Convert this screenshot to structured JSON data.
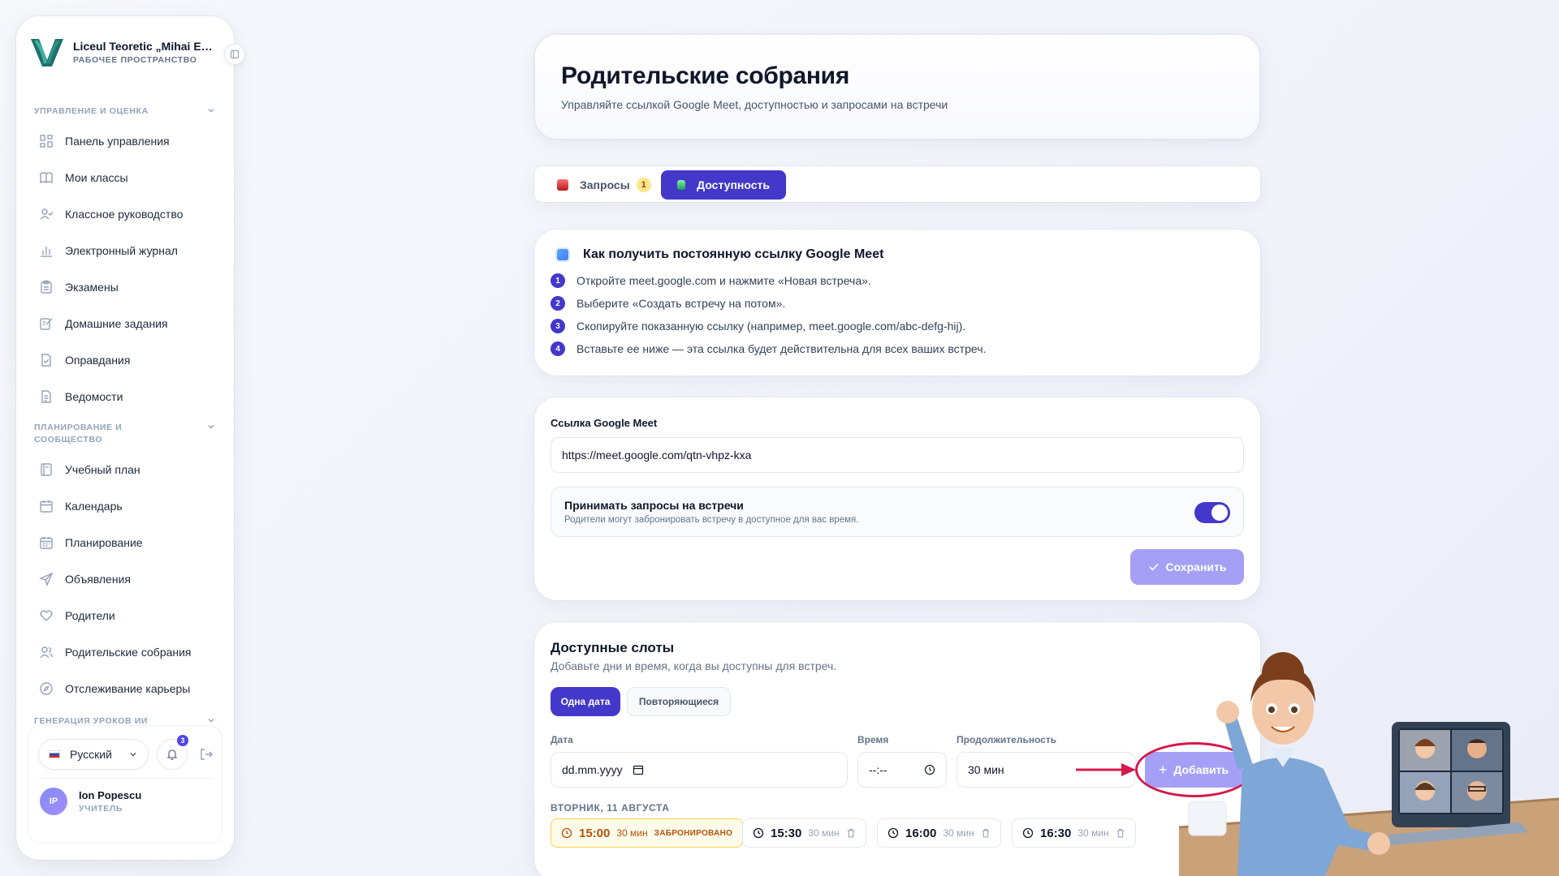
{
  "workspace": {
    "name": "Liceul Teoretic „Mihai Emi...",
    "subtitle": "РАБОЧЕЕ ПРОСТРАНСТВО"
  },
  "sidebar": {
    "sections": [
      {
        "title": "УПРАВЛЕНИЕ И ОЦЕНКА"
      },
      {
        "title": "ПЛАНИРОВАНИЕ И СООБЩЕСТВО"
      },
      {
        "title": "ГЕНЕРАЦИЯ УРОКОВ ИИ"
      }
    ],
    "items": [
      {
        "label": "Панель управления",
        "icon": "grid-icon"
      },
      {
        "label": "Мои классы",
        "icon": "book-open-icon"
      },
      {
        "label": "Классное руководство",
        "icon": "user-check-icon"
      },
      {
        "label": "Электронный журнал",
        "icon": "bar-chart-icon"
      },
      {
        "label": "Экзамены",
        "icon": "clipboard-icon"
      },
      {
        "label": "Домашние задания",
        "icon": "edit-note-icon"
      },
      {
        "label": "Оправдания",
        "icon": "file-check-icon"
      },
      {
        "label": "Ведомости",
        "icon": "file-text-icon"
      },
      {
        "label": "Учебный план",
        "icon": "notebook-icon"
      },
      {
        "label": "Календарь",
        "icon": "calendar-icon"
      },
      {
        "label": "Планирование",
        "icon": "calendar-grid-icon"
      },
      {
        "label": "Объявления",
        "icon": "send-icon"
      },
      {
        "label": "Родители",
        "icon": "heart-icon"
      },
      {
        "label": "Родительские собрания",
        "icon": "users-icon"
      },
      {
        "label": "Отслеживание карьеры",
        "icon": "compass-icon"
      }
    ],
    "footer": {
      "language": "Русский",
      "notifications_count": "3",
      "user_initials": "IP",
      "user_name": "Ion Popescu",
      "user_role": "УЧИТЕЛЬ"
    }
  },
  "page": {
    "title": "Родительские собрания",
    "subtitle": "Управляйте ссылкой Google Meet, доступностью и запросами на встречи"
  },
  "tabs": [
    {
      "label": "Запросы",
      "count": "1",
      "active": false
    },
    {
      "label": "Доступность",
      "active": true
    }
  ],
  "howto": {
    "title": "Как получить постоянную ссылку Google Meet",
    "steps": [
      {
        "n": "1",
        "text": "Откройте meet.google.com и нажмите «Новая встреча»."
      },
      {
        "n": "2",
        "text": "Выберите «Создать встречу на потом»."
      },
      {
        "n": "3",
        "text": "Скопируйте показанную ссылку (например, meet.google.com/abc-defg-hij)."
      },
      {
        "n": "4",
        "text": "Вставьте ее ниже — эта ссылка будет действительна для всех ваших встреч."
      }
    ]
  },
  "meet": {
    "label": "Ссылка Google Meet",
    "value": "https://meet.google.com/qtn-vhpz-kxa",
    "toggle_title": "Принимать запросы на встречи",
    "toggle_sub": "Родители могут забронировать встречу в доступное для вас время.",
    "toggle_on": true,
    "save_label": "Сохранить"
  },
  "slots": {
    "title": "Доступные слоты",
    "subtitle": "Добавьте дни и время, когда вы доступны для встреч.",
    "modes": [
      "Одна дата",
      "Повторяющиеся"
    ],
    "date_label": "Дата",
    "date_value": "dd.mm.yyyy",
    "time_label": "Время",
    "time_value": "--:--",
    "duration_label": "Продолжительность",
    "duration_value": "30 мин",
    "add_label": "Добавить",
    "day_heading": "ВТОРНИК, 11 АВГУСТА",
    "items": [
      {
        "time": "15:00",
        "duration": "30 мин",
        "badge": "ЗАБРОНИРОВАНО",
        "booked": true
      },
      {
        "time": "15:30",
        "duration": "30 мин",
        "booked": false
      },
      {
        "time": "16:00",
        "duration": "30 мин",
        "booked": false
      },
      {
        "time": "16:30",
        "duration": "30 мин",
        "booked": false
      }
    ]
  },
  "colors": {
    "accent": "#4338ca",
    "accent_light": "#a5a0f5",
    "highlight": "#d6194b",
    "booked": "#b45309"
  }
}
